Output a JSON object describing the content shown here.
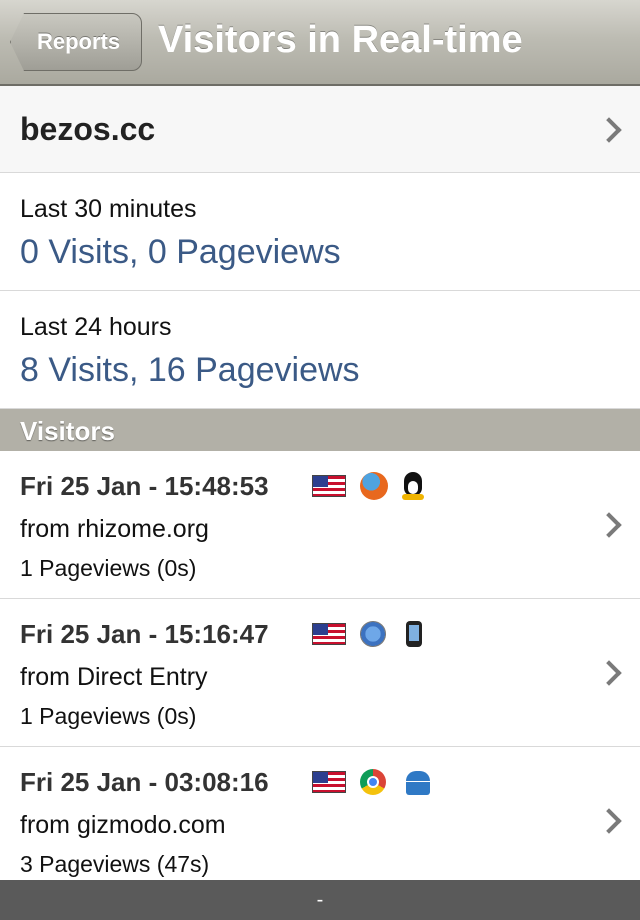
{
  "navbar": {
    "back_label": "Reports",
    "title": "Visitors in Real-time"
  },
  "site": {
    "name": "bezos.cc"
  },
  "stats": [
    {
      "label": "Last 30 minutes",
      "value": "0 Visits, 0 Pageviews"
    },
    {
      "label": "Last 24 hours",
      "value": "8 Visits, 16 Pageviews"
    }
  ],
  "section": {
    "title": "Visitors"
  },
  "visitors": [
    {
      "time": "Fri 25 Jan - 15:48:53",
      "from": "from rhizome.org",
      "pageviews": "1 Pageviews (0s)",
      "icons": [
        "us-flag-icon",
        "firefox-icon",
        "linux-tux-icon"
      ]
    },
    {
      "time": "Fri 25 Jan - 15:16:47",
      "from": "from Direct Entry",
      "pageviews": "1 Pageviews (0s)",
      "icons": [
        "us-flag-icon",
        "safari-icon",
        "iphone-icon"
      ]
    },
    {
      "time": "Fri 25 Jan - 03:08:16",
      "from": "from gizmodo.com",
      "pageviews": "3 Pageviews (47s)",
      "icons": [
        "us-flag-icon",
        "chrome-icon",
        "android-icon"
      ]
    }
  ],
  "bottom_bar": {
    "text": "-"
  },
  "colors": {
    "link_blue": "#3b5a86",
    "navbar_gray": "#bdbcb3",
    "section_gray": "#b2b0a7"
  }
}
